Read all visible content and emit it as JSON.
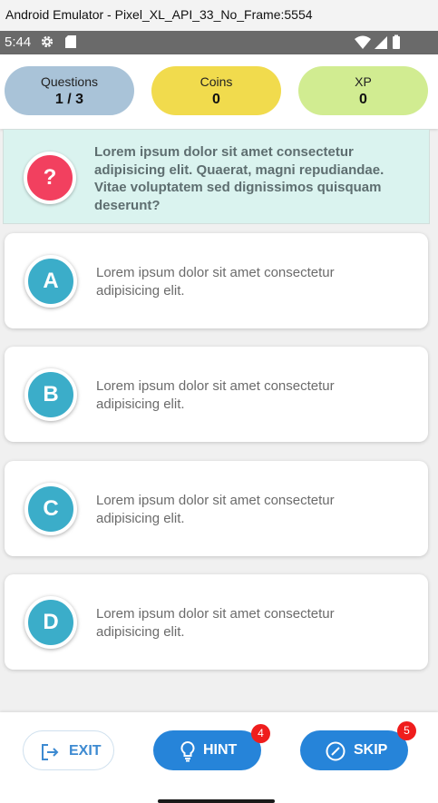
{
  "window": {
    "title": "Android Emulator - Pixel_XL_API_33_No_Frame:5554"
  },
  "status_bar": {
    "time": "5:44",
    "icons": [
      "gear-icon",
      "sd-card-icon",
      "wifi-icon",
      "signal-icon",
      "battery-icon"
    ]
  },
  "stats": {
    "questions": {
      "label": "Questions",
      "value": "1 / 3",
      "color": "#a9c3d8"
    },
    "coins": {
      "label": "Coins",
      "value": "0",
      "color": "#f1db4d"
    },
    "xp": {
      "label": "XP",
      "value": "0",
      "color": "#d1ec91"
    }
  },
  "question": {
    "badge": "?",
    "text": "Lorem ipsum dolor sit amet consectetur adipisicing elit. Quaerat, magni repudiandae. Vitae voluptatem sed dignissimos quisquam deserunt?"
  },
  "options": [
    {
      "letter": "A",
      "text": "Lorem ipsum dolor sit amet consectetur adipisicing elit."
    },
    {
      "letter": "B",
      "text": "Lorem ipsum dolor sit amet consectetur adipisicing elit."
    },
    {
      "letter": "C",
      "text": "Lorem ipsum dolor sit amet consectetur adipisicing elit."
    },
    {
      "letter": "D",
      "text": "Lorem ipsum dolor sit amet consectetur adipisicing elit."
    }
  ],
  "actions": {
    "exit": {
      "label": "EXIT",
      "icon": "exit-icon"
    },
    "hint": {
      "label": "HINT",
      "icon": "lightbulb-icon",
      "count": "4"
    },
    "skip": {
      "label": "SKIP",
      "icon": "skip-icon",
      "count": "5"
    }
  },
  "colors": {
    "accent": "#2684d9",
    "option_badge": "#3badc9",
    "question_badge": "#f2405f",
    "question_bg": "#daf3ef",
    "count_badge": "#ef1d1d"
  }
}
